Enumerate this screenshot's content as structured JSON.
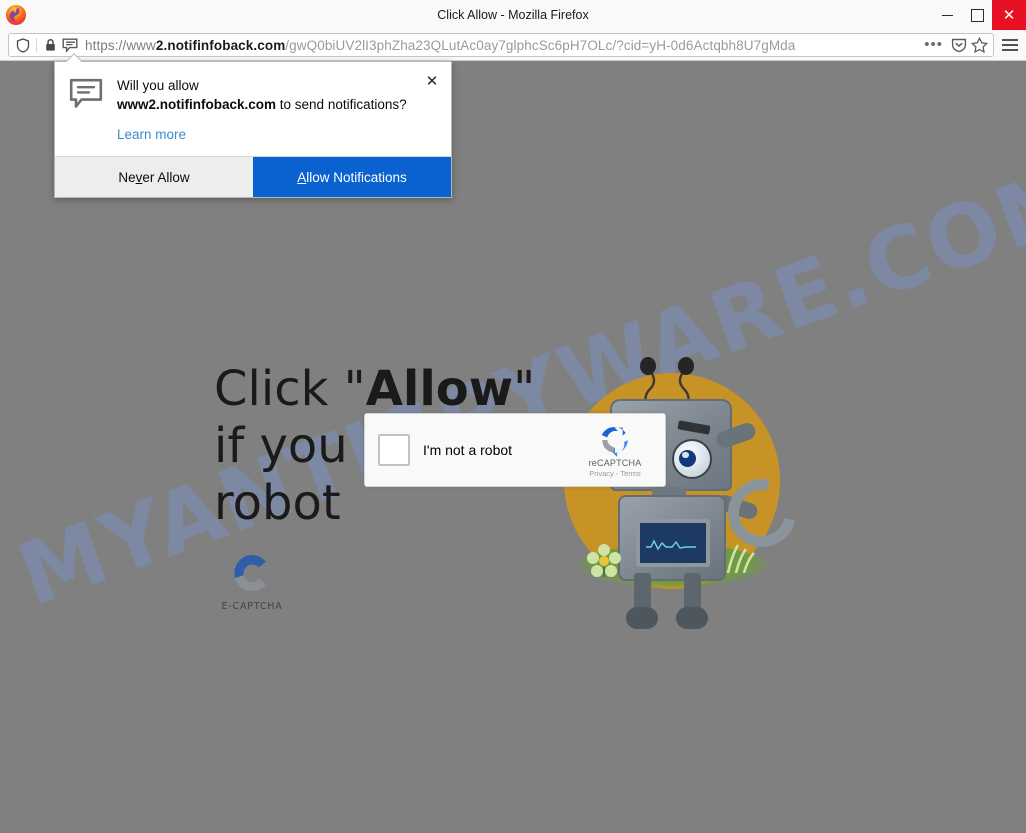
{
  "window": {
    "title": "Click Allow - Mozilla Firefox",
    "minimize_label": "Minimize",
    "maximize_label": "Maximize",
    "close_label": "✕",
    "logo_name": "firefox-logo"
  },
  "navbar": {
    "url_scheme": "https://www",
    "url_subdomain": "2.",
    "url_domain": "notifinfoback.com",
    "url_path": "/gwQ0biUV2lI3phZha23QLutAc0ay7glphcSc6pH7OLc/?cid=yH-0d6Actqbh8U7gMda",
    "page_actions_label": "•••",
    "icons": {
      "tracking_protection": "shield-icon",
      "lock": "lock-icon",
      "notification_permission": "notification-bubble-icon",
      "pocket": "pocket-save-icon",
      "bookmark": "star-icon",
      "menu": "hamburger-menu-icon"
    }
  },
  "popup": {
    "question_prefix": "Will you allow",
    "domain": "www2.notifinfoback.com",
    "question_suffix": "to send notifications?",
    "learn_more": "Learn more",
    "close_glyph": "✕",
    "never_allow": {
      "prefix": "Ne",
      "accel": "v",
      "suffix": "er Allow"
    },
    "allow": {
      "accel": "A",
      "suffix": "llow Notifications"
    },
    "colors": {
      "primary": "#0a61d0",
      "secondary": "#ededed",
      "link": "#3b8ccf"
    }
  },
  "page": {
    "headline_part1": "Click \"",
    "headline_bold": "Allow",
    "headline_part2": "\" if you are robot",
    "watermark": "MYANTISPYWARE.COM",
    "background_color": "#808080",
    "ecaptcha_label": "E-CAPTCHA",
    "recaptcha": {
      "checkbox_label": "I'm not a robot",
      "brand": "reCAPTCHA",
      "terms": "Privacy - Terms"
    }
  }
}
